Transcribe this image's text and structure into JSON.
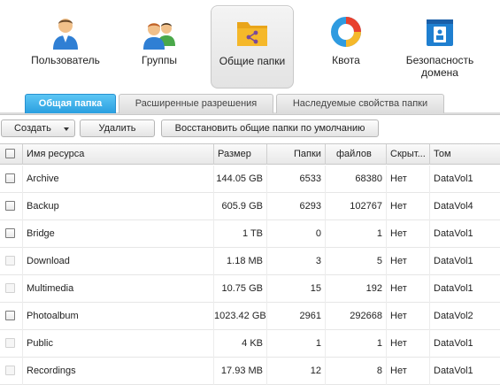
{
  "categories": [
    {
      "label": "Пользователь",
      "icon": "user-icon",
      "active": false
    },
    {
      "label": "Группы",
      "icon": "group-icon",
      "active": false
    },
    {
      "label": "Общие папки",
      "icon": "shared-folder-icon",
      "active": true
    },
    {
      "label": "Квота",
      "icon": "quota-chart-icon",
      "active": false
    },
    {
      "label": "Безопасность домена",
      "icon": "domain-security-icon",
      "active": false
    }
  ],
  "tabs": [
    {
      "label": "Общая папка",
      "active": true
    },
    {
      "label": "Расширенные разрешения",
      "active": false
    },
    {
      "label": "Наследуемые свойства папки",
      "active": false
    }
  ],
  "toolbar": {
    "create_label": "Создать",
    "delete_label": "Удалить",
    "restore_label": "Восстановить общие папки по умолчанию"
  },
  "table": {
    "columns": [
      "Имя ресурса",
      "Размер",
      "Папки",
      "файлов",
      "Скрыт...",
      "Том"
    ],
    "rows": [
      {
        "name": "Archive",
        "size": "144.05 GB",
        "folders": "6533",
        "files": "68380",
        "hidden": "Нет",
        "volume": "DataVol1",
        "checkbox_enabled": true
      },
      {
        "name": "Backup",
        "size": "605.9 GB",
        "folders": "6293",
        "files": "102767",
        "hidden": "Нет",
        "volume": "DataVol4",
        "checkbox_enabled": true
      },
      {
        "name": "Bridge",
        "size": "1 TB",
        "folders": "0",
        "files": "1",
        "hidden": "Нет",
        "volume": "DataVol1",
        "checkbox_enabled": true
      },
      {
        "name": "Download",
        "size": "1.18 MB",
        "folders": "3",
        "files": "5",
        "hidden": "Нет",
        "volume": "DataVol1",
        "checkbox_enabled": false
      },
      {
        "name": "Multimedia",
        "size": "10.75 GB",
        "folders": "15",
        "files": "192",
        "hidden": "Нет",
        "volume": "DataVol1",
        "checkbox_enabled": false
      },
      {
        "name": "Photoalbum",
        "size": "1023.42 GB",
        "folders": "2961",
        "files": "292668",
        "hidden": "Нет",
        "volume": "DataVol2",
        "checkbox_enabled": true
      },
      {
        "name": "Public",
        "size": "4 KB",
        "folders": "1",
        "files": "1",
        "hidden": "Нет",
        "volume": "DataVol1",
        "checkbox_enabled": false
      },
      {
        "name": "Recordings",
        "size": "17.93 MB",
        "folders": "12",
        "files": "8",
        "hidden": "Нет",
        "volume": "DataVol1",
        "checkbox_enabled": false
      }
    ]
  },
  "colors": {
    "active_tab": "#2a9fe0",
    "user_blue": "#2f7fd4",
    "group_green": "#4aa84a",
    "folder_yellow": "#f5b82a",
    "quota_ring": [
      "#e8412e",
      "#f5b82a",
      "#2f9be0"
    ],
    "security_blue": "#1f7fd0"
  }
}
